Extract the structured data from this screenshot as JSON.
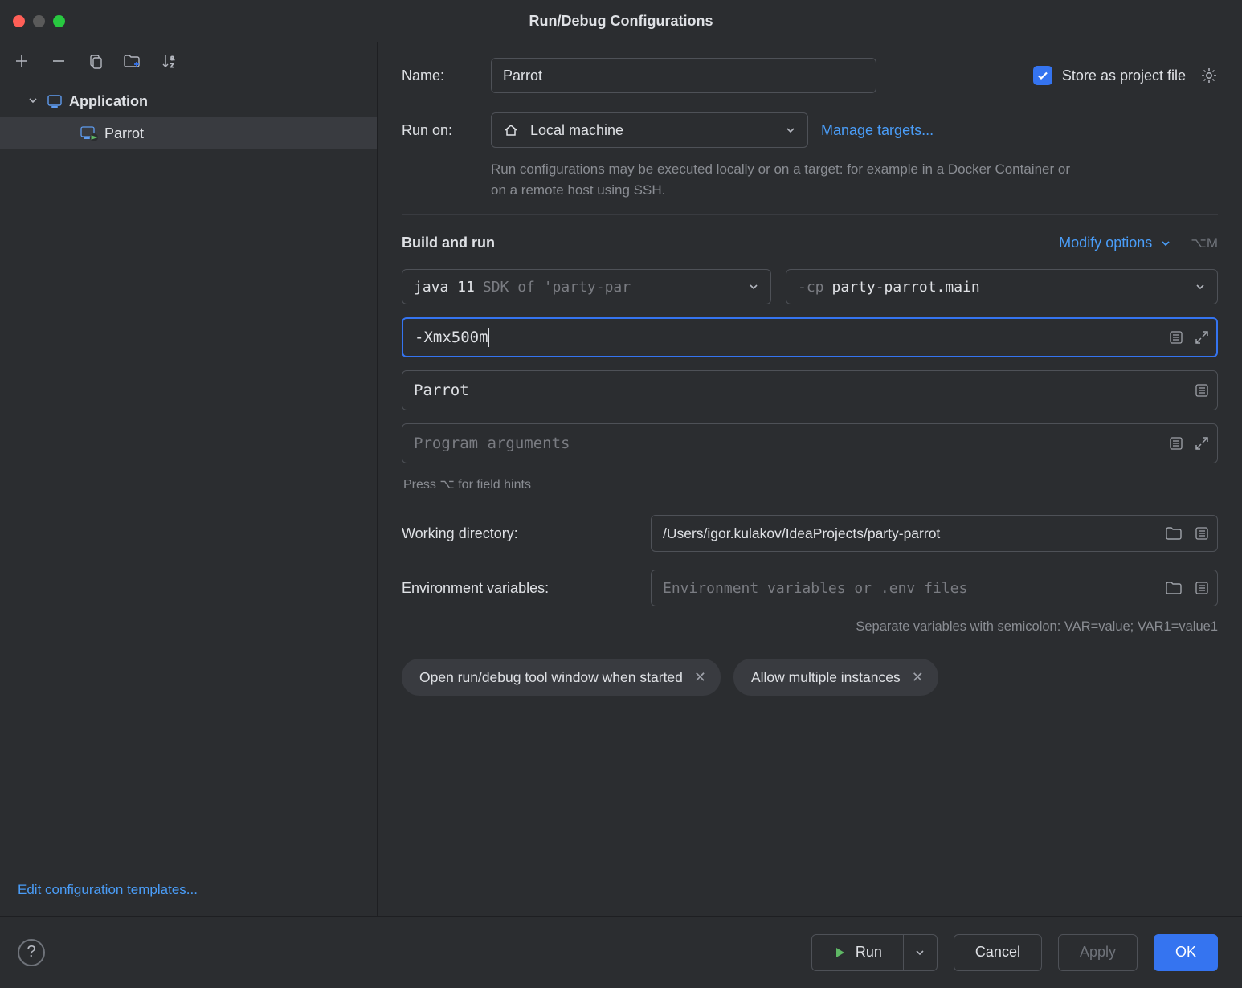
{
  "window": {
    "title": "Run/Debug Configurations"
  },
  "sidebar": {
    "items": [
      {
        "label": "Application",
        "expanded": true
      },
      {
        "label": "Parrot",
        "selected": true
      }
    ],
    "footer_link": "Edit configuration templates..."
  },
  "form": {
    "name_label": "Name:",
    "name_value": "Parrot",
    "store_checkbox_label": "Store as project file",
    "store_checked": true,
    "runon_label": "Run on:",
    "runon_value": "Local machine",
    "manage_targets": "Manage targets...",
    "runon_hint": "Run configurations may be executed locally or on a target: for example in a Docker Container or on a remote host using SSH.",
    "section_title": "Build and run",
    "modify_options": "Modify options",
    "modify_shortcut": "⌥M",
    "jdk": {
      "main": "java 11",
      "suffix": "SDK of 'party-par"
    },
    "classpath": {
      "prefix": "-cp",
      "value": "party-parrot.main"
    },
    "vm_options": "-Xmx500m",
    "main_class": "Parrot",
    "program_args_placeholder": "Program arguments",
    "field_hints": "Press ⌥ for field hints",
    "wd_label": "Working directory:",
    "wd_value": "/Users/igor.kulakov/IdeaProjects/party-parrot",
    "env_label": "Environment variables:",
    "env_placeholder": "Environment variables or .env files",
    "env_hint": "Separate variables with semicolon: VAR=value; VAR1=value1",
    "chips": [
      "Open run/debug tool window when started",
      "Allow multiple instances"
    ]
  },
  "footer": {
    "run": "Run",
    "cancel": "Cancel",
    "apply": "Apply",
    "ok": "OK"
  }
}
